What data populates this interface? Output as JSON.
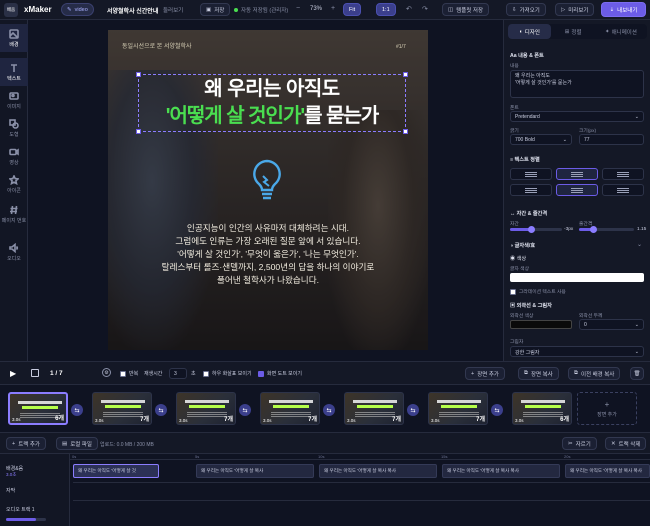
{
  "app": {
    "logo": "배움",
    "name": "xMaker",
    "mode": "video",
    "project_title": "서양철학사 신간안내",
    "menu": "둘러보기"
  },
  "toolbar": {
    "save": "저장",
    "autosave": "자동 저장됨 (관리자)",
    "zoom": "73%",
    "fit": "Fit",
    "ratio": "1:1",
    "template_save": "템플릿 저장",
    "import": "가져오기",
    "preview": "미리보기",
    "export": "내보내기"
  },
  "sidebar": {
    "items": [
      {
        "label": "배경",
        "icon": "image-icon"
      },
      {
        "label": "텍스트",
        "icon": "text-icon"
      },
      {
        "label": "이미지",
        "icon": "photo-icon"
      },
      {
        "label": "도형",
        "icon": "shape-icon"
      },
      {
        "label": "영상",
        "icon": "video-icon"
      },
      {
        "label": "아이콘",
        "icon": "star-icon"
      },
      {
        "label": "페이지 번호",
        "icon": "hash-icon"
      },
      {
        "label": "오디오",
        "icon": "audio-icon"
      }
    ]
  },
  "slide": {
    "badge": "동일시선으로 본 서양철학사",
    "page": "#1/7",
    "title_line1": "왜 우리는 아직도",
    "title_highlight": "'어떻게 살 것인가'",
    "title_rest": "를 묻는가",
    "body": [
      "인공지능이 인간의 사유마저 대체하려는 시대.",
      "그럼에도 인류는 가장 오래된 질문 앞에 서 있습니다.",
      "'어떻게 살 것인가', '무엇이 옳은가', '나는 무엇인가'.",
      "탈레스부터 롤즈·샌델까지, 2,500년의 답을 하나의 이야기로",
      "풀어낸 철학사가 나왔습니다."
    ]
  },
  "panel": {
    "tabs": [
      "디자인",
      "정렬",
      "애니메이션"
    ],
    "content_section": "내용 & 폰트",
    "content_label": "내용",
    "content_value": "왜 우리는 아직도\n'어떻게 살 것인가'를 묻는가",
    "font_label": "폰트",
    "font_value": "Pretendard",
    "weight_label": "굵기",
    "weight_value": "700 Bold",
    "size_label": "크기(px)",
    "size_value": "77",
    "align_section": "텍스트 정렬",
    "spacing_section": "자간 & 줄간격",
    "letter_label": "자간",
    "letter_value": "-3px",
    "line_label": "줄간격",
    "line_value": "1.15",
    "color_section": "글자색/효",
    "color_sub": "색상",
    "text_color_label": "글자 색상",
    "gradient_label": "그라데이션 텍스트 사용",
    "stroke_section": "외곽선 & 그림자",
    "stroke_color_label": "외곽선 색상",
    "stroke_width_label": "외곽선 두께",
    "stroke_width_value": "0",
    "shadow_label": "그림자",
    "shadow_value": "강한 그림자"
  },
  "controls": {
    "page_indicator": "1 / 7",
    "repeat_label": "반복",
    "playtime_label": "재생시간",
    "playtime_value": "3",
    "seconds": "초",
    "caption_label": "하우 화살표 보이기",
    "transition_label": "화면 도트 보이기",
    "add_scene": "장면 추가",
    "copy_scene": "장면 복사",
    "prev_bg_copy": "이전 배경 복사"
  },
  "thumbnails": [
    {
      "num": "6개",
      "dur": "3.0s"
    },
    {
      "num": "7개",
      "dur": "3.0s"
    },
    {
      "num": "7개",
      "dur": "3.0s"
    },
    {
      "num": "7개",
      "dur": "3.0s"
    },
    {
      "num": "7개",
      "dur": "3.0s"
    },
    {
      "num": "7개",
      "dur": "3.0s"
    },
    {
      "num": "6개",
      "dur": "3.0s"
    }
  ],
  "add_scene_tile": "장면 추가",
  "timeline": {
    "add_track": "트랙 추가",
    "local_file": "로컬 파일",
    "capacity": "업로드: 0.0 MB / 200 MB",
    "cut": "자르기",
    "delete_track": "트랙 삭제",
    "track1_name": "배경&음",
    "track1_sub": "3.0초",
    "track2_name": "자막",
    "track3_name": "오디오 트랙 1",
    "clips": [
      "왜 우리는 아직도 '어떻게 살 것",
      "왜 우리는 아직도 '어떻게 살 복사",
      "왜 우리는 아직도 '어떻게 살 복사 복사",
      "왜 우리는 아직도 '어떻게 살 복사 복사",
      "왜 우리는 아직도 '어떻게 살 복사 복사"
    ],
    "ruler": [
      "0s",
      "5s",
      "10s",
      "15s",
      "20s"
    ]
  },
  "colors": {
    "accent": "#6c5ce7",
    "highlight": "#4ade50",
    "bg": "#0f1322"
  }
}
